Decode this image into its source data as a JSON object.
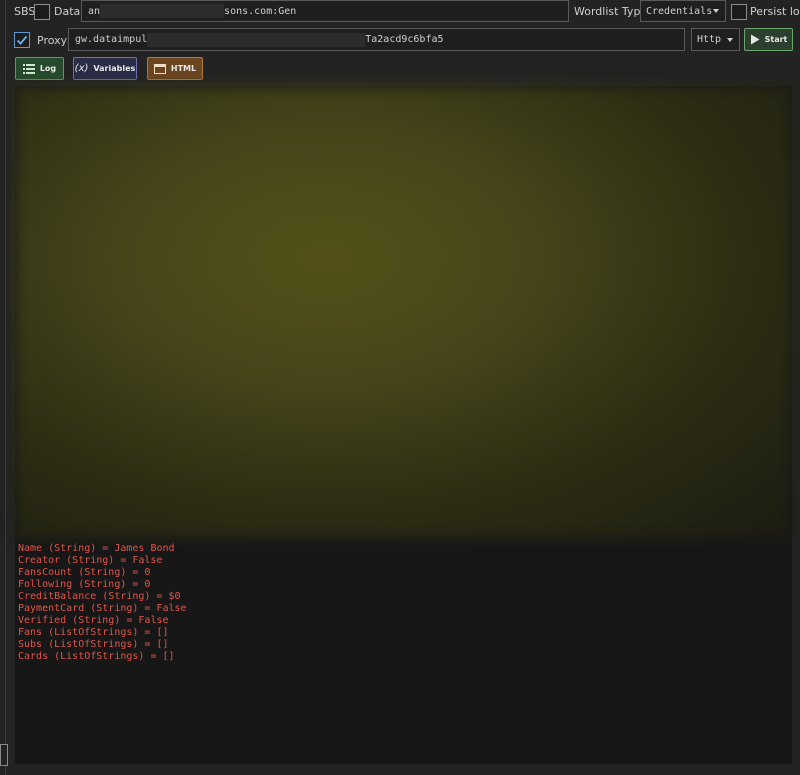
{
  "top_row": {
    "sbs_label": "SBS",
    "data_label": "Data",
    "data_value_start": "an",
    "data_value_end": "sons.com:Gen",
    "wordlist_type_label": "Wordlist Type",
    "wordlist_type_value": "Credentials",
    "persist_log_label": "Persist log"
  },
  "proxy_row": {
    "proxy_label": "Proxy",
    "proxy_value_start": "gw.dataimpul",
    "proxy_value_end": "Ta2acd9c6bfa5",
    "proxy_type_value": "Http",
    "start_label": "Start"
  },
  "tabs": {
    "log_label": "Log",
    "variables_label": "Variables",
    "html_label": "HTML",
    "variables_icon_glyph": "(x)"
  },
  "output_lines": [
    "Name (String) = James Bond",
    "Creator (String) = False",
    "FansCount (String) = 0",
    "Following (String) = 0",
    "CreditBalance (String) = $0",
    "PaymentCard (String) = False",
    "Verified (String) = False",
    "Fans (ListOfStrings) = []",
    "Subs (ListOfStrings) = []",
    "Cards (ListOfStrings) = []"
  ],
  "colors": {
    "background": "#232323",
    "output_text": "#e0554a",
    "accent_green": "#6aa86f",
    "accent_blue": "#6a72b0",
    "accent_orange": "#b47a3c",
    "checkbox_accent": "#5b9bd5"
  }
}
